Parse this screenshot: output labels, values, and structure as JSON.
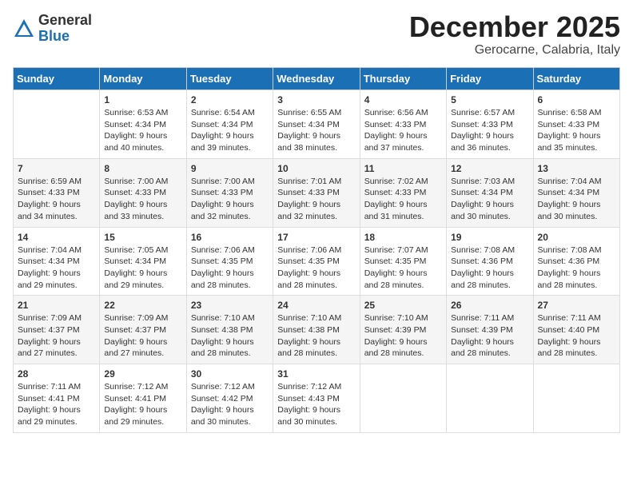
{
  "header": {
    "logo": {
      "general": "General",
      "blue": "Blue"
    },
    "title": "December 2025",
    "subtitle": "Gerocarne, Calabria, Italy"
  },
  "days_of_week": [
    "Sunday",
    "Monday",
    "Tuesday",
    "Wednesday",
    "Thursday",
    "Friday",
    "Saturday"
  ],
  "weeks": [
    [
      {
        "day": "",
        "sunrise": "",
        "sunset": "",
        "daylight": ""
      },
      {
        "day": "1",
        "sunrise": "Sunrise: 6:53 AM",
        "sunset": "Sunset: 4:34 PM",
        "daylight": "Daylight: 9 hours and 40 minutes."
      },
      {
        "day": "2",
        "sunrise": "Sunrise: 6:54 AM",
        "sunset": "Sunset: 4:34 PM",
        "daylight": "Daylight: 9 hours and 39 minutes."
      },
      {
        "day": "3",
        "sunrise": "Sunrise: 6:55 AM",
        "sunset": "Sunset: 4:34 PM",
        "daylight": "Daylight: 9 hours and 38 minutes."
      },
      {
        "day": "4",
        "sunrise": "Sunrise: 6:56 AM",
        "sunset": "Sunset: 4:33 PM",
        "daylight": "Daylight: 9 hours and 37 minutes."
      },
      {
        "day": "5",
        "sunrise": "Sunrise: 6:57 AM",
        "sunset": "Sunset: 4:33 PM",
        "daylight": "Daylight: 9 hours and 36 minutes."
      },
      {
        "day": "6",
        "sunrise": "Sunrise: 6:58 AM",
        "sunset": "Sunset: 4:33 PM",
        "daylight": "Daylight: 9 hours and 35 minutes."
      }
    ],
    [
      {
        "day": "7",
        "sunrise": "Sunrise: 6:59 AM",
        "sunset": "Sunset: 4:33 PM",
        "daylight": "Daylight: 9 hours and 34 minutes."
      },
      {
        "day": "8",
        "sunrise": "Sunrise: 7:00 AM",
        "sunset": "Sunset: 4:33 PM",
        "daylight": "Daylight: 9 hours and 33 minutes."
      },
      {
        "day": "9",
        "sunrise": "Sunrise: 7:00 AM",
        "sunset": "Sunset: 4:33 PM",
        "daylight": "Daylight: 9 hours and 32 minutes."
      },
      {
        "day": "10",
        "sunrise": "Sunrise: 7:01 AM",
        "sunset": "Sunset: 4:33 PM",
        "daylight": "Daylight: 9 hours and 32 minutes."
      },
      {
        "day": "11",
        "sunrise": "Sunrise: 7:02 AM",
        "sunset": "Sunset: 4:33 PM",
        "daylight": "Daylight: 9 hours and 31 minutes."
      },
      {
        "day": "12",
        "sunrise": "Sunrise: 7:03 AM",
        "sunset": "Sunset: 4:34 PM",
        "daylight": "Daylight: 9 hours and 30 minutes."
      },
      {
        "day": "13",
        "sunrise": "Sunrise: 7:04 AM",
        "sunset": "Sunset: 4:34 PM",
        "daylight": "Daylight: 9 hours and 30 minutes."
      }
    ],
    [
      {
        "day": "14",
        "sunrise": "Sunrise: 7:04 AM",
        "sunset": "Sunset: 4:34 PM",
        "daylight": "Daylight: 9 hours and 29 minutes."
      },
      {
        "day": "15",
        "sunrise": "Sunrise: 7:05 AM",
        "sunset": "Sunset: 4:34 PM",
        "daylight": "Daylight: 9 hours and 29 minutes."
      },
      {
        "day": "16",
        "sunrise": "Sunrise: 7:06 AM",
        "sunset": "Sunset: 4:35 PM",
        "daylight": "Daylight: 9 hours and 28 minutes."
      },
      {
        "day": "17",
        "sunrise": "Sunrise: 7:06 AM",
        "sunset": "Sunset: 4:35 PM",
        "daylight": "Daylight: 9 hours and 28 minutes."
      },
      {
        "day": "18",
        "sunrise": "Sunrise: 7:07 AM",
        "sunset": "Sunset: 4:35 PM",
        "daylight": "Daylight: 9 hours and 28 minutes."
      },
      {
        "day": "19",
        "sunrise": "Sunrise: 7:08 AM",
        "sunset": "Sunset: 4:36 PM",
        "daylight": "Daylight: 9 hours and 28 minutes."
      },
      {
        "day": "20",
        "sunrise": "Sunrise: 7:08 AM",
        "sunset": "Sunset: 4:36 PM",
        "daylight": "Daylight: 9 hours and 28 minutes."
      }
    ],
    [
      {
        "day": "21",
        "sunrise": "Sunrise: 7:09 AM",
        "sunset": "Sunset: 4:37 PM",
        "daylight": "Daylight: 9 hours and 27 minutes."
      },
      {
        "day": "22",
        "sunrise": "Sunrise: 7:09 AM",
        "sunset": "Sunset: 4:37 PM",
        "daylight": "Daylight: 9 hours and 27 minutes."
      },
      {
        "day": "23",
        "sunrise": "Sunrise: 7:10 AM",
        "sunset": "Sunset: 4:38 PM",
        "daylight": "Daylight: 9 hours and 28 minutes."
      },
      {
        "day": "24",
        "sunrise": "Sunrise: 7:10 AM",
        "sunset": "Sunset: 4:38 PM",
        "daylight": "Daylight: 9 hours and 28 minutes."
      },
      {
        "day": "25",
        "sunrise": "Sunrise: 7:10 AM",
        "sunset": "Sunset: 4:39 PM",
        "daylight": "Daylight: 9 hours and 28 minutes."
      },
      {
        "day": "26",
        "sunrise": "Sunrise: 7:11 AM",
        "sunset": "Sunset: 4:39 PM",
        "daylight": "Daylight: 9 hours and 28 minutes."
      },
      {
        "day": "27",
        "sunrise": "Sunrise: 7:11 AM",
        "sunset": "Sunset: 4:40 PM",
        "daylight": "Daylight: 9 hours and 28 minutes."
      }
    ],
    [
      {
        "day": "28",
        "sunrise": "Sunrise: 7:11 AM",
        "sunset": "Sunset: 4:41 PM",
        "daylight": "Daylight: 9 hours and 29 minutes."
      },
      {
        "day": "29",
        "sunrise": "Sunrise: 7:12 AM",
        "sunset": "Sunset: 4:41 PM",
        "daylight": "Daylight: 9 hours and 29 minutes."
      },
      {
        "day": "30",
        "sunrise": "Sunrise: 7:12 AM",
        "sunset": "Sunset: 4:42 PM",
        "daylight": "Daylight: 9 hours and 30 minutes."
      },
      {
        "day": "31",
        "sunrise": "Sunrise: 7:12 AM",
        "sunset": "Sunset: 4:43 PM",
        "daylight": "Daylight: 9 hours and 30 minutes."
      },
      {
        "day": "",
        "sunrise": "",
        "sunset": "",
        "daylight": ""
      },
      {
        "day": "",
        "sunrise": "",
        "sunset": "",
        "daylight": ""
      },
      {
        "day": "",
        "sunrise": "",
        "sunset": "",
        "daylight": ""
      }
    ]
  ]
}
